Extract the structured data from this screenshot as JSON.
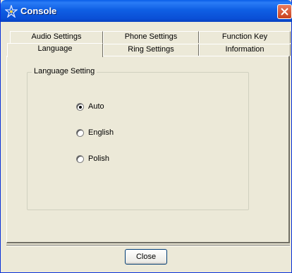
{
  "window": {
    "title": "Console"
  },
  "tabs": {
    "row1": [
      "Audio Settings",
      "Phone Settings",
      "Function Key"
    ],
    "row2": [
      "Language",
      "Ring Settings",
      "Information"
    ],
    "active": "Language"
  },
  "group": {
    "label": "Language Setting",
    "options": [
      {
        "label": "Auto",
        "checked": true
      },
      {
        "label": "English",
        "checked": false
      },
      {
        "label": "Polish",
        "checked": false
      }
    ]
  },
  "buttons": {
    "close": "Close"
  },
  "colors": {
    "titlebar": "#0a5ee8",
    "face": "#ece9d8",
    "close_button": "#c9411d"
  }
}
